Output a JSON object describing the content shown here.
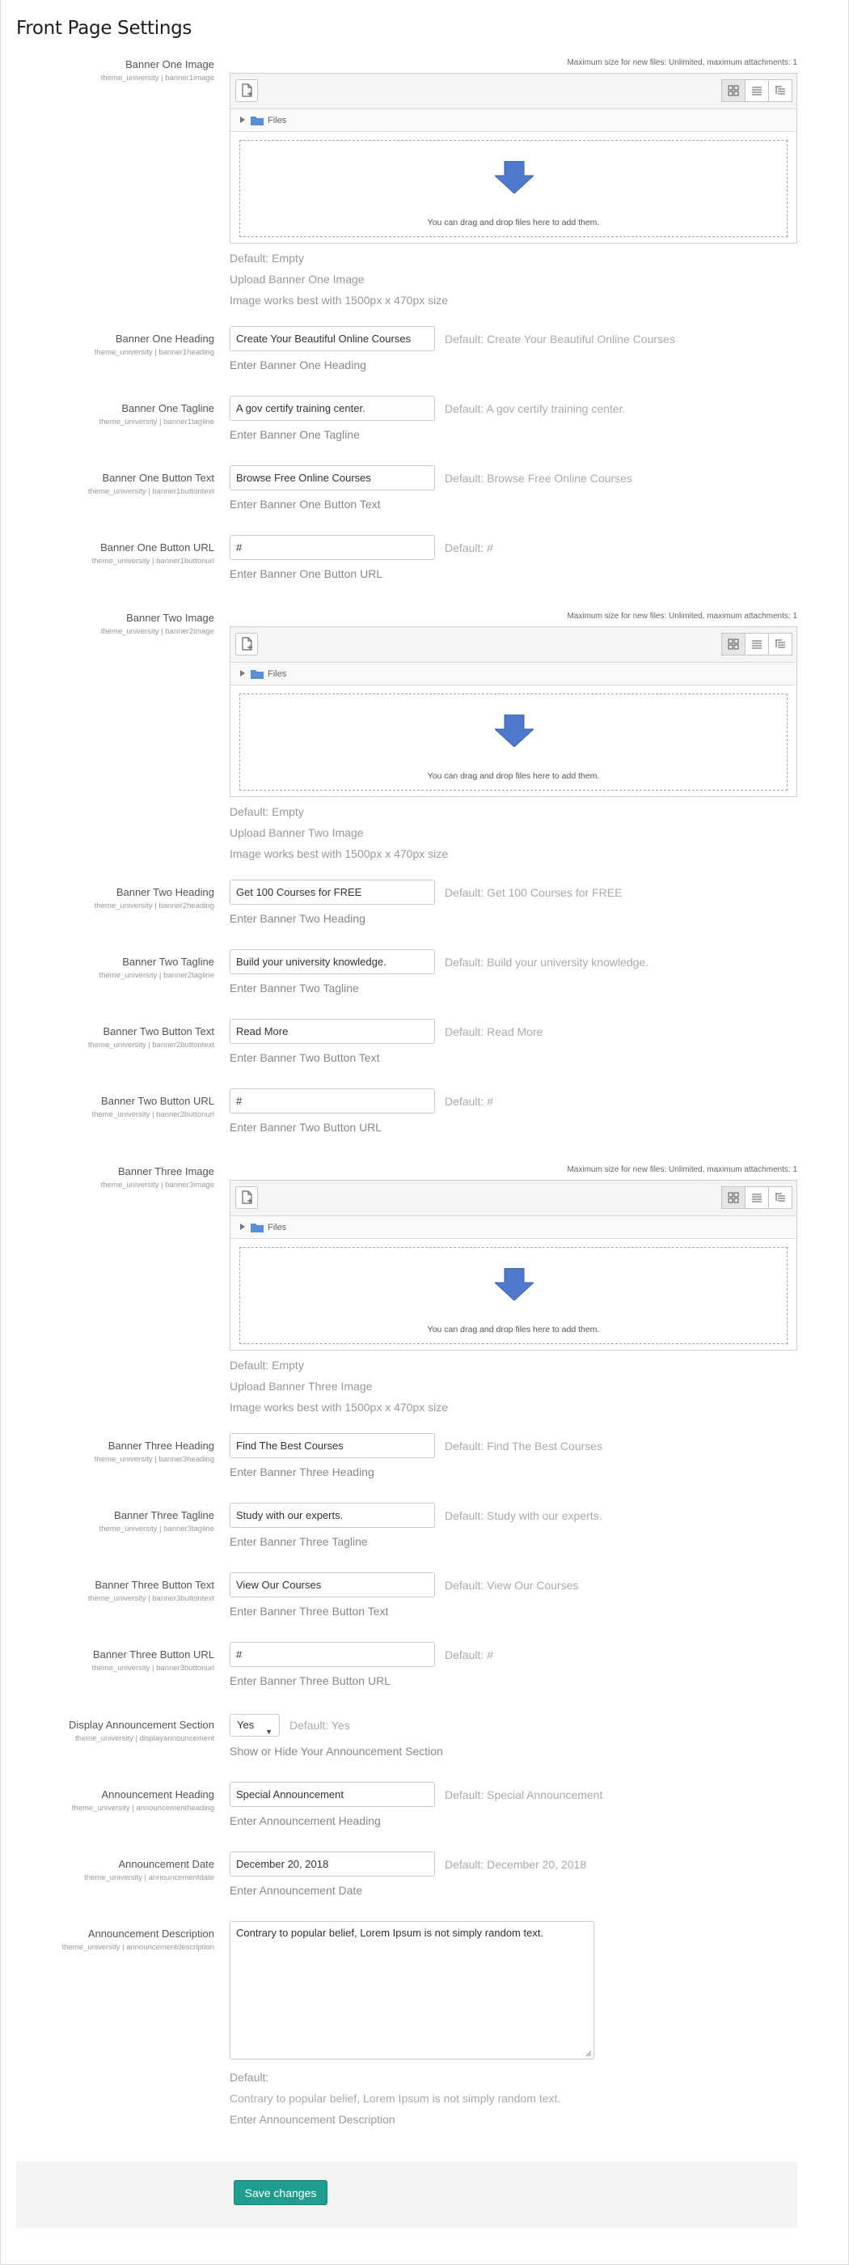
{
  "page_title": "Front Page Settings",
  "filepicker": {
    "maxsize": "Maximum size for new files: Unlimited, maximum attachments: 1",
    "files_label": "Files",
    "drop_text": "You can drag and drop files here to add them."
  },
  "banners": [
    {
      "image": {
        "label": "Banner One Image",
        "sub": "theme_university | banner1image",
        "default": "Default: Empty",
        "desc1": "Upload Banner One Image",
        "desc2": "Image works best with 1500px x 470px size"
      },
      "heading": {
        "label": "Banner One Heading",
        "sub": "theme_university | banner1heading",
        "value": "Create Your Beautiful Online Courses",
        "default": "Default: Create Your Beautiful Online Courses",
        "desc": "Enter Banner One Heading"
      },
      "tagline": {
        "label": "Banner One Tagline",
        "sub": "theme_university | banner1tagline",
        "value": "A gov certify training center.",
        "default": "Default: A gov certify training center.",
        "desc": "Enter Banner One Tagline"
      },
      "button_text": {
        "label": "Banner One Button Text",
        "sub": "theme_university | banner1buttontext",
        "value": "Browse Free Online Courses",
        "default": "Default: Browse Free Online Courses",
        "desc": "Enter Banner One Button Text"
      },
      "button_url": {
        "label": "Banner One Button URL",
        "sub": "theme_university | banner1buttonurl",
        "value": "#",
        "default": "Default: #",
        "desc": "Enter Banner One Button URL"
      }
    },
    {
      "image": {
        "label": "Banner Two Image",
        "sub": "theme_university | banner2image",
        "default": "Default: Empty",
        "desc1": "Upload Banner Two Image",
        "desc2": "Image works best with 1500px x 470px size"
      },
      "heading": {
        "label": "Banner Two Heading",
        "sub": "theme_university | banner2heading",
        "value": "Get 100 Courses for FREE",
        "default": "Default: Get 100 Courses for FREE",
        "desc": "Enter Banner Two Heading"
      },
      "tagline": {
        "label": "Banner Two Tagline",
        "sub": "theme_university | banner2tagline",
        "value": "Build your university knowledge.",
        "default": "Default: Build your university knowledge.",
        "desc": "Enter Banner Two Tagline"
      },
      "button_text": {
        "label": "Banner Two Button Text",
        "sub": "theme_university | banner2buttontext",
        "value": "Read More",
        "default": "Default: Read More",
        "desc": "Enter Banner Two Button Text"
      },
      "button_url": {
        "label": "Banner Two Button URL",
        "sub": "theme_university | banner2buttonurl",
        "value": "#",
        "default": "Default: #",
        "desc": "Enter Banner Two Button URL"
      }
    },
    {
      "image": {
        "label": "Banner Three Image",
        "sub": "theme_university | banner3image",
        "default": "Default: Empty",
        "desc1": "Upload Banner Three Image",
        "desc2": "Image works best with 1500px x 470px size"
      },
      "heading": {
        "label": "Banner Three Heading",
        "sub": "theme_university | banner3heading",
        "value": "Find The Best Courses",
        "default": "Default: Find The Best Courses",
        "desc": "Enter Banner Three Heading"
      },
      "tagline": {
        "label": "Banner Three Tagline",
        "sub": "theme_university | banner3tagline",
        "value": "Study with our experts.",
        "default": "Default: Study with our experts.",
        "desc": "Enter Banner Three Tagline"
      },
      "button_text": {
        "label": "Banner Three Button Text",
        "sub": "theme_university | banner3buttontext",
        "value": "View Our Courses",
        "default": "Default: View Our Courses",
        "desc": "Enter Banner Three Button Text"
      },
      "button_url": {
        "label": "Banner Three Button URL",
        "sub": "theme_university | banner3buttonurl",
        "value": "#",
        "default": "Default: #",
        "desc": "Enter Banner Three Button URL"
      }
    }
  ],
  "announcement": {
    "display": {
      "label": "Display Announcement Section",
      "sub": "theme_university | displayannouncement",
      "value": "Yes",
      "default": "Default: Yes",
      "desc": "Show or Hide Your Announcement Section"
    },
    "heading": {
      "label": "Announcement Heading",
      "sub": "theme_university | announcementheading",
      "value": "Special Announcement",
      "default": "Default: Special Announcement",
      "desc": "Enter Announcement Heading"
    },
    "date": {
      "label": "Announcement Date",
      "sub": "theme_university | announcementdate",
      "value": "December 20, 2018",
      "default": "Default: December 20, 2018",
      "desc": "Enter Announcement Date"
    },
    "description": {
      "label": "Announcement Description",
      "sub": "theme_university | announcementdescription",
      "value": "Contrary to popular belief, Lorem Ipsum is not simply random text.",
      "default_label": "Default:",
      "default_value": "Contrary to popular belief, Lorem Ipsum is not simply random text.",
      "desc": "Enter Announcement Description"
    }
  },
  "save_button": "Save changes",
  "colors": {
    "accent": "#1f9e8f",
    "folder": "#5a8fd6",
    "arrow": "#4f79cc"
  }
}
